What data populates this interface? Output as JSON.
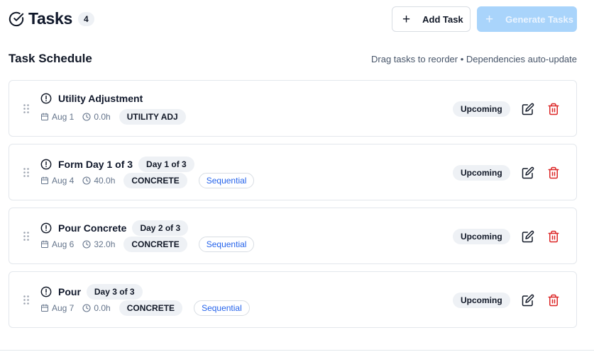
{
  "header": {
    "title": "Tasks",
    "count": "4",
    "add_label": "Add Task",
    "generate_label": "Generate Tasks"
  },
  "section": {
    "title": "Task Schedule",
    "hint": "Drag tasks to reorder • Dependencies auto-update"
  },
  "tasks": [
    {
      "name": "Utility Adjustment",
      "day": "",
      "date": "Aug 1",
      "hours": "0.0h",
      "category": "UTILITY ADJ",
      "sequential": "",
      "status": "Upcoming"
    },
    {
      "name": "Form Day 1 of 3",
      "day": "Day 1 of 3",
      "date": "Aug 4",
      "hours": "40.0h",
      "category": "CONCRETE",
      "sequential": "Sequential",
      "status": "Upcoming"
    },
    {
      "name": "Pour Concrete",
      "day": "Day 2 of 3",
      "date": "Aug 6",
      "hours": "32.0h",
      "category": "CONCRETE",
      "sequential": "Sequential",
      "status": "Upcoming"
    },
    {
      "name": "Pour",
      "day": "Day 3 of 3",
      "date": "Aug 7",
      "hours": "0.0h",
      "category": "CONCRETE",
      "sequential": "Sequential",
      "status": "Upcoming"
    }
  ],
  "colors": {
    "primary_disabled": "#a9d4fb",
    "delete": "#dc2626",
    "sequential": "#2563eb"
  },
  "icons": {
    "title": "circle-check-icon",
    "add": "plus-icon",
    "drag": "grip-vertical-icon",
    "priority": "alert-circle-icon",
    "date": "calendar-icon",
    "hours": "clock-icon",
    "edit": "edit-icon",
    "delete": "trash-icon"
  }
}
